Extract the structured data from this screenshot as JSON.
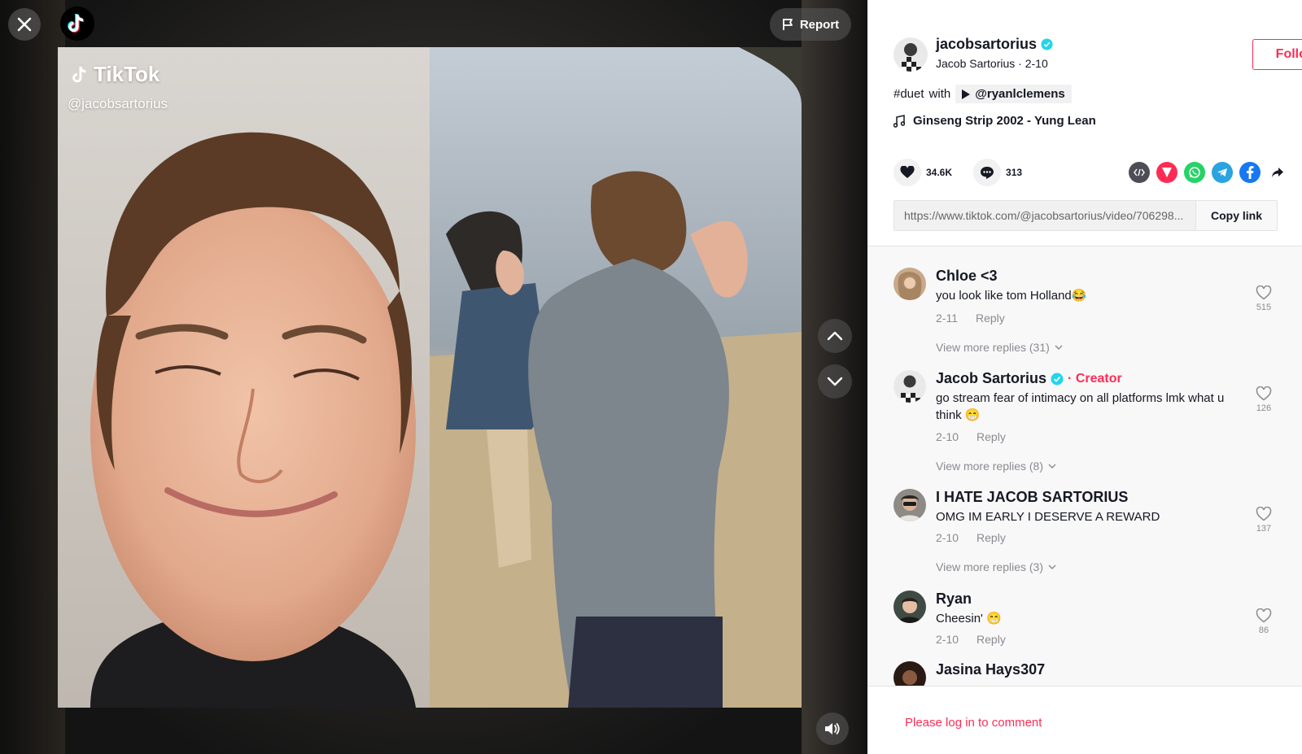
{
  "video": {
    "report_label": "Report",
    "watermark_brand": "TikTok",
    "watermark_handle": "@jacobsartorius"
  },
  "post": {
    "username": "jacobsartorius",
    "subline": "Jacob Sartorius · 2-10",
    "follow_label": "Follow",
    "caption_tag": "#duet",
    "caption_with": "with",
    "duet_user": "@ryanlclemens",
    "music": "Ginseng Strip 2002 - Yung Lean",
    "likes": "34.6K",
    "comments": "313",
    "link": "https://www.tiktok.com/@jacobsartorius/video/706298...",
    "copy_label": "Copy link"
  },
  "comments": [
    {
      "name": "Chloe <3",
      "text": "you look like tom Holland😂",
      "date": "2-11",
      "reply": "Reply",
      "likes": "515",
      "more": "View more replies (31)"
    },
    {
      "name": "Jacob Sartorius",
      "badge": "· Creator",
      "text": "go stream fear of intimacy on all platforms lmk what u think 😁",
      "date": "2-10",
      "reply": "Reply",
      "likes": "126",
      "more": "View more replies (8)"
    },
    {
      "name": "I HATE JACOB SARTORIUS",
      "text": "OMG IM EARLY I DESERVE A REWARD",
      "date": "2-10",
      "reply": "Reply",
      "likes": "137",
      "more": "View more replies (3)"
    },
    {
      "name": "Ryan",
      "text": "Cheesin' 😁",
      "date": "2-10",
      "reply": "Reply",
      "likes": "86"
    },
    {
      "name": "Jasina Hays307"
    }
  ],
  "login_prompt": "Please log in to comment",
  "colors": {
    "accent": "#fe2c55",
    "verified": "#20d5ec",
    "text": "#161823",
    "muted": "#8a8b91"
  }
}
